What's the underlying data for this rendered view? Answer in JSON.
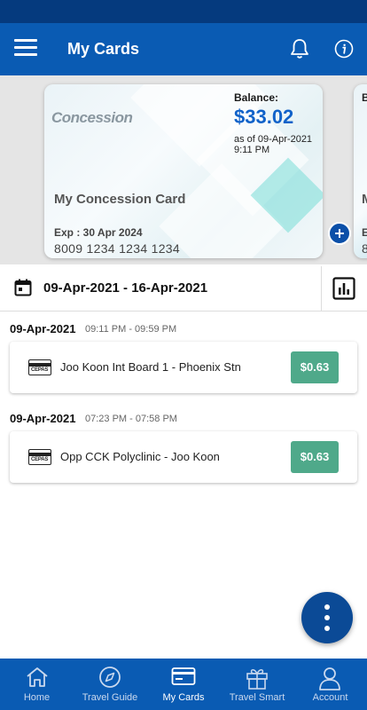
{
  "header": {
    "title": "My Cards"
  },
  "card": {
    "brand": "Concession",
    "balance_label": "Balance:",
    "balance": "$33.02",
    "as_of": "as of 09-Apr-2021",
    "time": "9:11 PM",
    "name": "My Concession Card",
    "expiry": "Exp : 30 Apr 2024",
    "number": "8009 1234 1234 1234"
  },
  "card_peek": {
    "b": "B",
    "m": "M",
    "e": "E",
    "n": "8"
  },
  "date_range": "09-Apr-2021 - 16-Apr-2021",
  "trips": [
    {
      "date": "09-Apr-2021",
      "time": "09:11 PM - 09:59 PM",
      "route": "Joo Koon Int Board 1 - Phoenix Stn",
      "fare": "$0.63",
      "card_type": "CEPAS"
    },
    {
      "date": "09-Apr-2021",
      "time": "07:23 PM - 07:58 PM",
      "route": "Opp CCK Polyclinic - Joo Koon",
      "fare": "$0.63",
      "card_type": "CEPAS"
    }
  ],
  "nav": [
    {
      "label": "Home",
      "icon": "home-icon"
    },
    {
      "label": "Travel Guide",
      "icon": "compass-icon"
    },
    {
      "label": "My Cards",
      "icon": "card-icon",
      "active": true
    },
    {
      "label": "Travel Smart",
      "icon": "gift-icon"
    },
    {
      "label": "Account",
      "icon": "person-icon"
    }
  ],
  "colors": {
    "primary": "#0a5bb3",
    "status_bar": "#053a7e",
    "balance": "#1162c9",
    "fare": "#4fa98a"
  }
}
